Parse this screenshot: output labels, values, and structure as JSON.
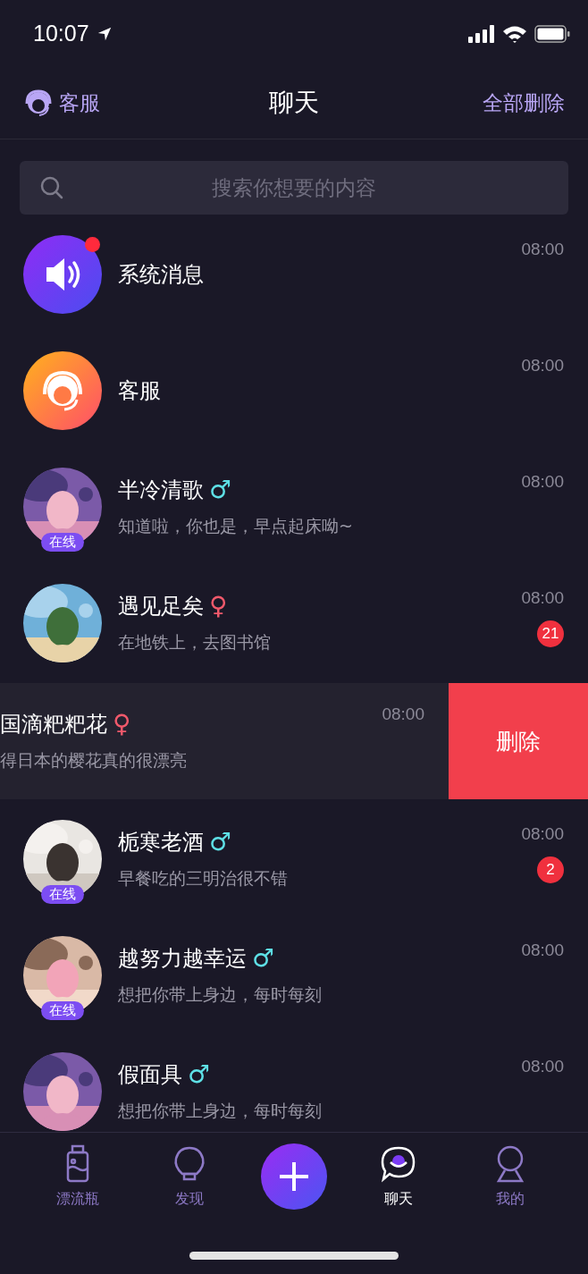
{
  "status_bar": {
    "time": "10:07"
  },
  "nav": {
    "left_label": "客服",
    "title": "聊天",
    "right_label": "全部删除"
  },
  "search": {
    "placeholder": "搜索你想要的内容"
  },
  "chats": [
    {
      "kind": "system",
      "name": "系统消息",
      "time": "08:00",
      "unread_dot": true
    },
    {
      "kind": "service",
      "name": "客服",
      "time": "08:00"
    },
    {
      "kind": "user",
      "name": "半冷清歌",
      "gender": {
        "sign": "♂",
        "color": "#5ee0e6"
      },
      "message": "知道啦，你也是，早点起床呦~",
      "time": "08:00",
      "online": true,
      "online_label": "在线"
    },
    {
      "kind": "user",
      "name": "遇见足矣",
      "gender": {
        "sign": "♀",
        "color": "#f0596b"
      },
      "message": "在地铁上，去图书馆",
      "time": "08:00",
      "badge": "21"
    },
    {
      "kind": "swiped",
      "name": "国滴粑粑花",
      "gender": {
        "sign": "♀",
        "color": "#f0596b"
      },
      "message": "得日本的樱花真的很漂亮",
      "time": "08:00",
      "action": "删除"
    },
    {
      "kind": "user",
      "name": "栀寒老酒",
      "gender": {
        "sign": "♂",
        "color": "#5ee0e6"
      },
      "message": "早餐吃的三明治很不错",
      "time": "08:00",
      "online": true,
      "online_label": "在线",
      "badge": "2"
    },
    {
      "kind": "user",
      "name": "越努力越幸运",
      "gender": {
        "sign": "♂",
        "color": "#5ee0e6"
      },
      "message": "想把你带上身边，每时每刻",
      "time": "08:00",
      "online": true,
      "online_label": "在线"
    },
    {
      "kind": "user",
      "name": "假面具",
      "gender": {
        "sign": "♂",
        "color": "#5ee0e6"
      },
      "message": "想把你带上身边，每时每刻",
      "time": "08:00"
    }
  ],
  "tabs": [
    {
      "kind": "bottle",
      "label": "漂流瓶",
      "selected": false
    },
    {
      "kind": "bulb",
      "label": "发现",
      "selected": false
    },
    {
      "kind": "plus"
    },
    {
      "kind": "chat",
      "label": "聊天",
      "selected": true
    },
    {
      "kind": "profile",
      "label": "我的",
      "selected": false
    }
  ]
}
